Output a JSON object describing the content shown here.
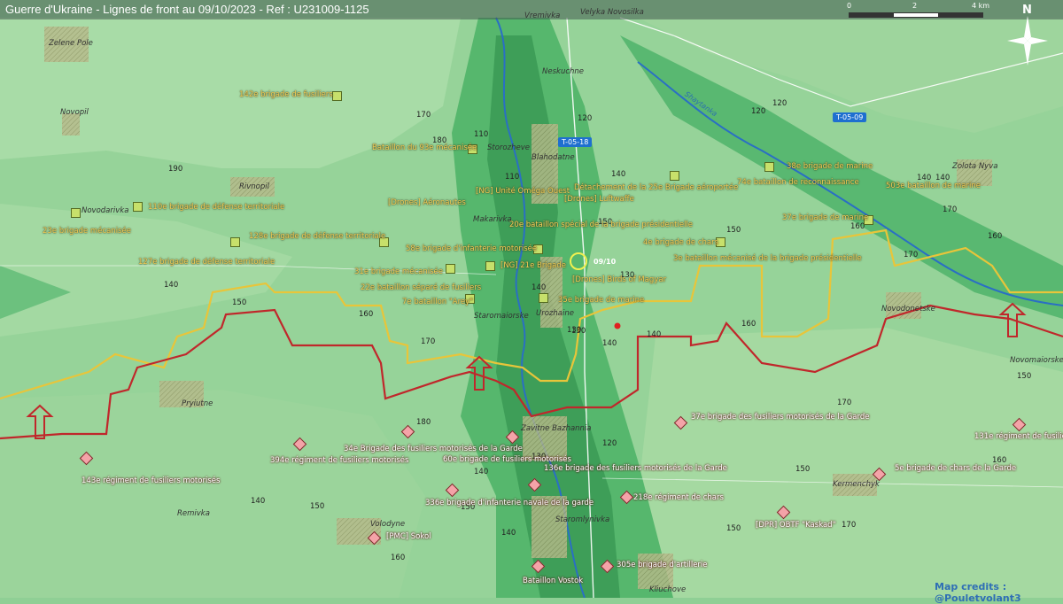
{
  "header": {
    "title": "Guerre d'Ukraine - Lignes de front au 09/10/2023 - Ref : U231009-1125"
  },
  "scale": {
    "labels": [
      "0",
      "2",
      "4 km"
    ]
  },
  "compass": {
    "label": "N"
  },
  "credits": "Map credits : @Pouletvolant3",
  "roads": [
    "T-05-18",
    "T-05-09"
  ],
  "river": "Shaytanka",
  "current_date_marker": "09/10",
  "towns": [
    "Vremivka",
    "Velyka Novosilka",
    "Zelene Pole",
    "Novopil",
    "Neskuchne",
    "Storozheve",
    "Blahodatne",
    "Rivnopil",
    "Novodarivka",
    "Makarivka",
    "Zolota Nyva",
    "Staromaiorske",
    "Urozhaine",
    "Novodonetske",
    "Novomaiorske",
    "Pryiutne",
    "Zavitne Bazhannia",
    "Kermenchyk",
    "Remivka",
    "Volodyne",
    "Staromlynivka",
    "Kliuchove"
  ],
  "elevations": [
    "170",
    "180",
    "190",
    "120",
    "110",
    "110",
    "120",
    "130",
    "140",
    "150",
    "140",
    "140",
    "160",
    "120",
    "140",
    "130",
    "160",
    "150",
    "170",
    "170",
    "140",
    "150",
    "160",
    "140",
    "130",
    "120",
    "150",
    "160",
    "130",
    "140",
    "150",
    "140",
    "150",
    "140",
    "170",
    "150",
    "160",
    "140",
    "170",
    "180",
    "170",
    "150",
    "160"
  ],
  "ukrainian_units": [
    "142e brigade de fusiliers",
    "Bataillon du 93e mécanisée",
    "[NG] Unité Oméga Ouest",
    "Détachement de la 25e Brigade aéroportée",
    "38e brigade de marine",
    "74e bataillon de reconnaissance",
    "503e bataillon de marine",
    "110e brigade de défense territoriale",
    "23e brigade mécanisée",
    "[Drones] Aéronautes",
    "[Drones] Luftwaffe",
    "37e brigade de marine",
    "128e brigade de défense territoriale",
    "20e bataillon spécial de la brigade présidentielle",
    "4e brigade de chars",
    "58e brigade d'infanterie motorisée",
    "127e brigade de défense territoriale",
    "[NG] 21e Brigade",
    "3e bataillon mécanisé de la brigade présidentielle",
    "31e brigade mécanisée",
    "[Drones] Birds of Magyar",
    "22e bataillon séparé de fusiliers",
    "7e bataillon \"Arey\"",
    "35e brigade de marine"
  ],
  "russian_units": [
    "37e brigade des fusiliers motorisés de la Garde",
    "131e régiment de fusiliers motorisés",
    "34e Brigade des fusiliers motorisés de la Garde",
    "394e régiment de fusiliers motorisés",
    "60e brigade de fusiliers motorisés",
    "143e régiment de fusiliers motorisés",
    "136e brigade des fusiliers motorisés de la Garde",
    "5e brigade de chars de la Garde",
    "336e brigade d'infanterie navale de la garde",
    "218e régiment de chars",
    "[DPR] OBTF \"Kaskad\"",
    "[PMC] Sokol",
    "305e brigade d'artillerie",
    "Bataillon Vostok"
  ],
  "colors": {
    "yellow_line": "#e8c53a",
    "red_line": "#c0272b",
    "low_terrain": "#4caf6a",
    "high_terrain": "#a9d9a2"
  }
}
